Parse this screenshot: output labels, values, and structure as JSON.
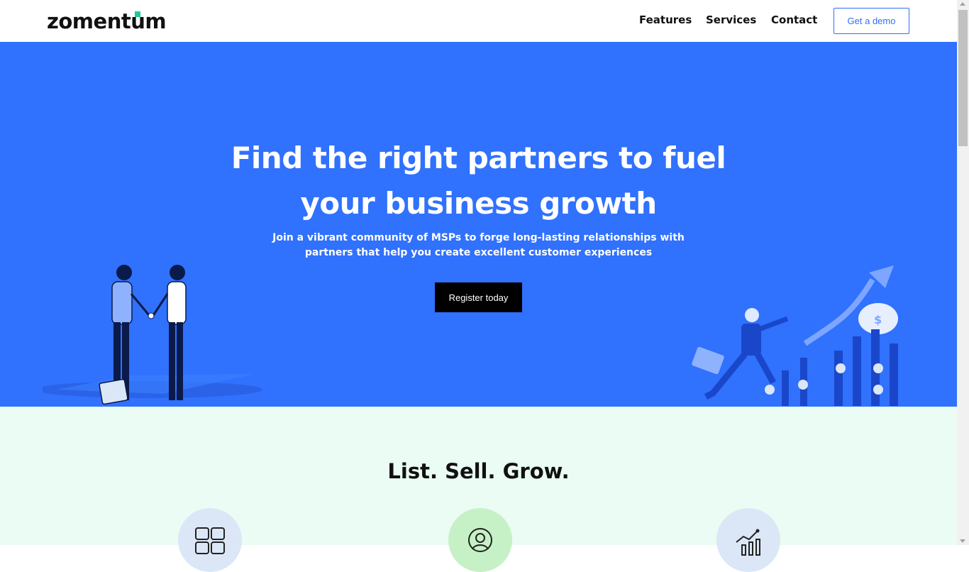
{
  "header": {
    "logo_text": "zomentum",
    "nav": [
      "Features",
      "Services",
      "Contact"
    ],
    "cta": "Get a demo"
  },
  "hero": {
    "title": "Find the right partners to fuel your business growth",
    "subtitle": "Join a vibrant community of MSPs to forge long-lasting relationships with partners that help you create excellent customer experiences",
    "cta": "Register today",
    "background_color": "#3071fe",
    "illustration_left": "handshake-illustration",
    "illustration_right": "growth-chart-illustration"
  },
  "section2": {
    "title": "List. Sell. Grow.",
    "background_color": "#eafcf3",
    "features": [
      {
        "icon": "layout-grid-icon",
        "color": "#dbe7f7"
      },
      {
        "icon": "user-headset-icon",
        "color": "#c6f1c6"
      },
      {
        "icon": "chart-growth-icon",
        "color": "#dbe7f7"
      }
    ]
  },
  "colors": {
    "accent": "#2f6fff",
    "logo_accent": "#1fc8a0"
  }
}
